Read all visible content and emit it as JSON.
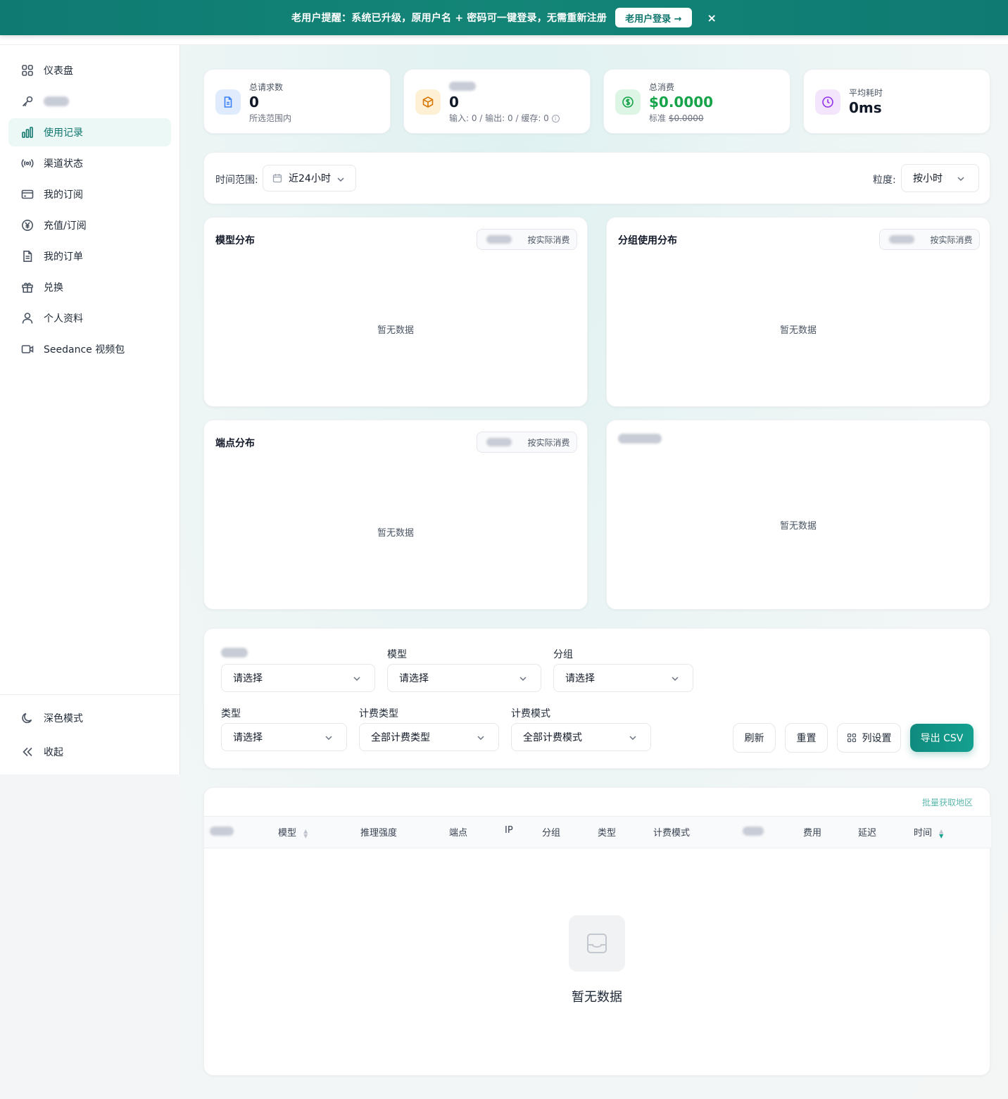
{
  "banner": {
    "message": "老用户提醒：系统已升级，原用户名 + 密码可一键登录，无需重新注册",
    "login_button": "老用户登录 →",
    "close": "×"
  },
  "sidebar": {
    "items": [
      {
        "label": "仪表盘",
        "icon": "grid-icon"
      },
      {
        "label": "",
        "icon": "key-icon",
        "blurred": true
      },
      {
        "label": "使用记录",
        "icon": "bar-chart-icon",
        "active": true
      },
      {
        "label": "渠道状态",
        "icon": "broadcast-icon"
      },
      {
        "label": "我的订阅",
        "icon": "credit-card-icon"
      },
      {
        "label": "充值/订阅",
        "icon": "yen-circle-icon"
      },
      {
        "label": "我的订单",
        "icon": "document-icon"
      },
      {
        "label": "兑换",
        "icon": "gift-icon"
      },
      {
        "label": "个人资料",
        "icon": "user-icon"
      },
      {
        "label": "Seedance 视频包",
        "icon": "video-icon"
      }
    ],
    "dark_mode": "深色模式",
    "collapse": "收起"
  },
  "stats": [
    {
      "label": "总请求数",
      "value": "0",
      "sub": "所选范围内",
      "icon": "document-icon",
      "color": "#3b82f6",
      "bg": "#e0ecfd"
    },
    {
      "label": "",
      "label_blurred": true,
      "value": "0",
      "sub": "输入: 0 / 输出: 0 / 缓存: 0",
      "icon": "cube-icon",
      "color": "#d97706",
      "bg": "#fdf0d5"
    },
    {
      "label": "总消费",
      "value": "$0.0000",
      "sub_prefix": "标准",
      "sub_strike": "$0.0000",
      "icon": "dollar-circle-icon",
      "color": "#16a34a",
      "bg": "#dcf5e4",
      "value_color": "#16a34a"
    },
    {
      "label": "平均耗时",
      "value": "0ms",
      "icon": "clock-icon",
      "color": "#9333ea",
      "bg": "#f3e5fb"
    }
  ],
  "filters_bar": {
    "time_range_label": "时间范围:",
    "time_range_value": "近24小时",
    "granularity_label": "粒度:",
    "granularity_value": "按小时"
  },
  "panels": [
    {
      "title": "模型分布",
      "toggle_b": "按实际消费",
      "empty": "暂无数据"
    },
    {
      "title": "分组使用分布",
      "toggle_b": "按实际消费",
      "empty": "暂无数据"
    },
    {
      "title": "端点分布",
      "toggle_b": "按实际消费",
      "empty": "暂无数据"
    },
    {
      "title": "",
      "title_blurred": true,
      "empty": "暂无数据"
    }
  ],
  "query_filters": {
    "row1": [
      {
        "label": "",
        "label_blurred": true,
        "placeholder": "请选择"
      },
      {
        "label": "模型",
        "placeholder": "请选择"
      },
      {
        "label": "分组",
        "placeholder": "请选择"
      }
    ],
    "row2": [
      {
        "label": "类型",
        "placeholder": "请选择"
      },
      {
        "label": "计费类型",
        "value": "全部计费类型"
      },
      {
        "label": "计费模式",
        "value": "全部计费模式"
      }
    ],
    "buttons": {
      "refresh": "刷新",
      "reset": "重置",
      "columns": "列设置",
      "export": "导出 CSV"
    }
  },
  "table": {
    "batch_link": "批量获取地区",
    "columns": [
      "",
      "模型",
      "推理强度",
      "端点",
      "IP",
      "分组",
      "类型",
      "计费模式",
      "",
      "费用",
      "延迟",
      "时间"
    ],
    "empty": "暂无数据"
  },
  "colors": {
    "accent": "#0f766e",
    "banner": "#138577",
    "export_button": "#14a08f"
  }
}
